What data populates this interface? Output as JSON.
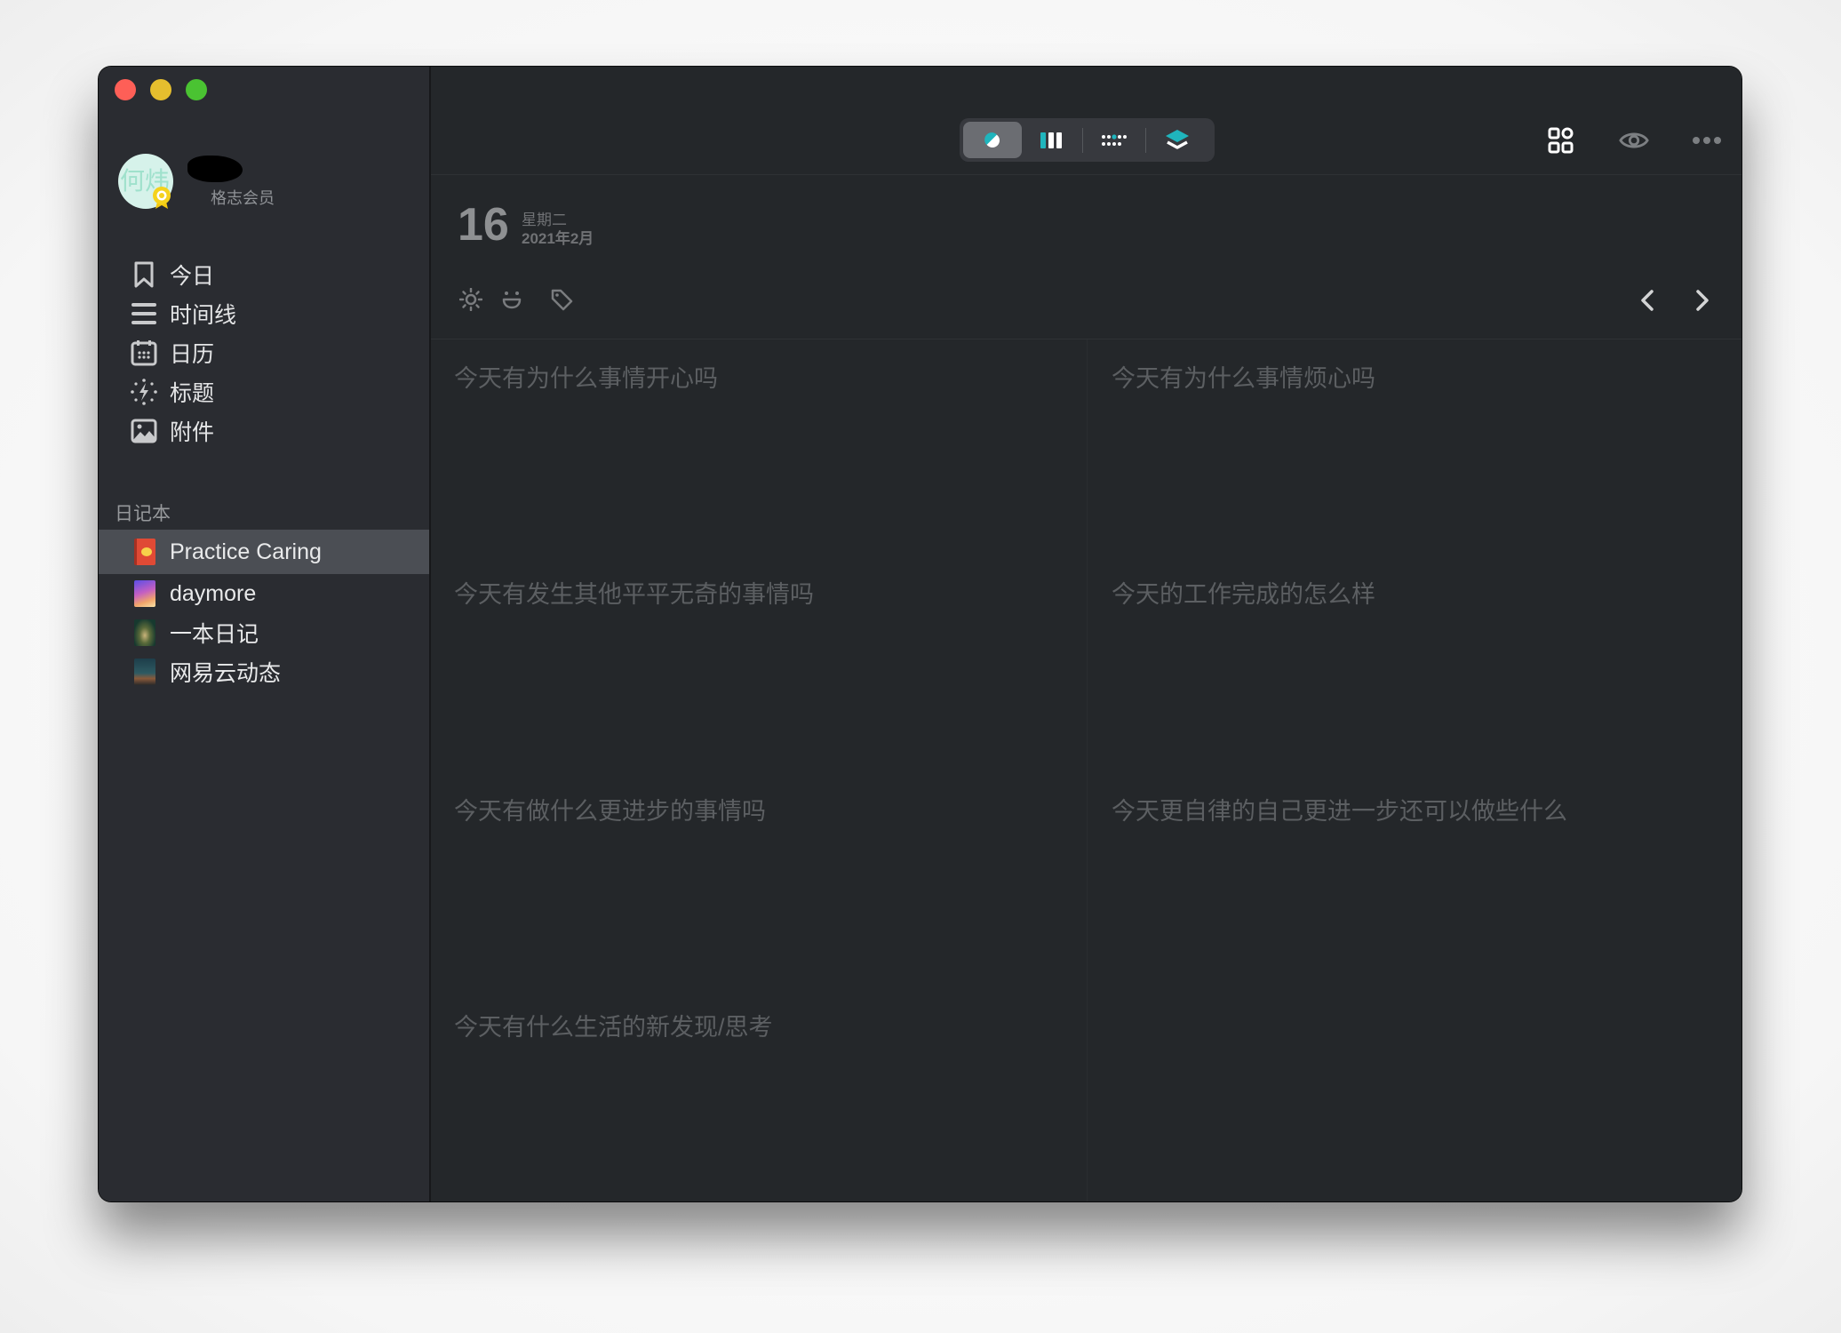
{
  "window": {
    "traffic_lights": [
      "close",
      "minimize",
      "zoom"
    ]
  },
  "profile": {
    "avatar_text": "何炜",
    "membership": "格志会员",
    "badge_icon": "award-icon"
  },
  "sidebar": {
    "nav": [
      {
        "label": "今日",
        "icon": "bookmark-icon"
      },
      {
        "label": "时间线",
        "icon": "list-icon"
      },
      {
        "label": "日历",
        "icon": "calendar-icon"
      },
      {
        "label": "标题",
        "icon": "sparkle-icon"
      },
      {
        "label": "附件",
        "icon": "image-icon"
      }
    ],
    "notebooks_title": "日记本",
    "notebooks": [
      {
        "label": "Practice Caring",
        "selected": true,
        "cover_color": "#e04a35"
      },
      {
        "label": "daymore",
        "selected": false,
        "cover_color": "#7a5be0"
      },
      {
        "label": "一本日记",
        "selected": false,
        "cover_color": "#1f4a3c"
      },
      {
        "label": "网易云动态",
        "selected": false,
        "cover_color": "#2b4f5a"
      }
    ]
  },
  "toolbar": {
    "segments": [
      {
        "name": "theme",
        "icon": "half-circle-icon",
        "active": true
      },
      {
        "name": "columns",
        "icon": "columns-icon",
        "active": false
      },
      {
        "name": "dots",
        "icon": "dot-grid-icon",
        "active": false
      },
      {
        "name": "layers",
        "icon": "layers-icon",
        "active": false
      }
    ],
    "right_icons": [
      "grid-icon",
      "eye-icon",
      "more-icon"
    ],
    "accent": "#1fb5bd"
  },
  "entry": {
    "day": "16",
    "weekday": "星期二",
    "month": "2021年2月",
    "tools": [
      "weather-icon",
      "mood-icon",
      "tag-icon"
    ],
    "prev_icon": "chevron-left-icon",
    "next_icon": "chevron-right-icon"
  },
  "prompts": [
    "今天有为什么事情开心吗",
    "今天有为什么事情烦心吗",
    "今天有发生其他平平无奇的事情吗",
    "今天的工作完成的怎么样",
    "今天有做什么更进步的事情吗",
    "今天更自律的自己更进一步还可以做些什么",
    "今天有什么生活的新发现/思考"
  ]
}
